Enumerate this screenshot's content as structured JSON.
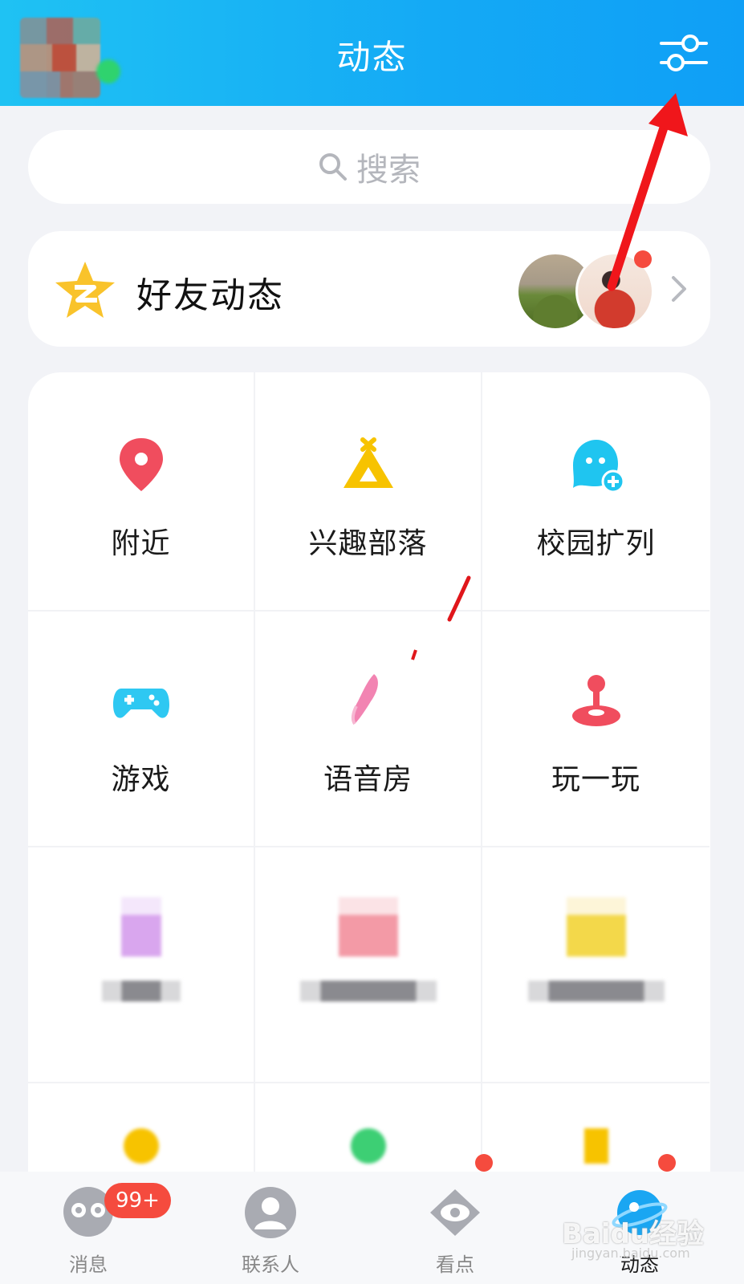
{
  "header": {
    "title": "动态"
  },
  "search": {
    "placeholder": "搜索"
  },
  "friends_card": {
    "title": "好友动态"
  },
  "grid": {
    "row1": [
      {
        "label": "附近",
        "icon": "location-pin-icon",
        "color": "#f04d5e"
      },
      {
        "label": "兴趣部落",
        "icon": "tent-icon",
        "color": "#f7c300"
      },
      {
        "label": "校园扩列",
        "icon": "ghost-add-icon",
        "color": "#1fc5f0"
      }
    ],
    "row2": [
      {
        "label": "游戏",
        "icon": "gamepad-icon",
        "color": "#2ec8f2"
      },
      {
        "label": "语音房",
        "icon": "microphone-icon",
        "color": "#f06fa4"
      },
      {
        "label": "玩一玩",
        "icon": "joystick-icon",
        "color": "#f04d5e"
      }
    ]
  },
  "tabbar": {
    "items": [
      {
        "label": "消息",
        "icon": "message-face-icon"
      },
      {
        "label": "联系人",
        "icon": "contacts-icon"
      },
      {
        "label": "看点",
        "icon": "eye-icon"
      },
      {
        "label": "动态",
        "icon": "planet-icon",
        "active": true
      }
    ],
    "message_badge": "99+"
  },
  "watermark": {
    "brand": "Baidu经验",
    "url": "jingyan.baidu.com"
  },
  "colors": {
    "header_blue": "#14a9f5",
    "badge_red": "#f54b3e",
    "annotation_red": "#f0161b"
  }
}
